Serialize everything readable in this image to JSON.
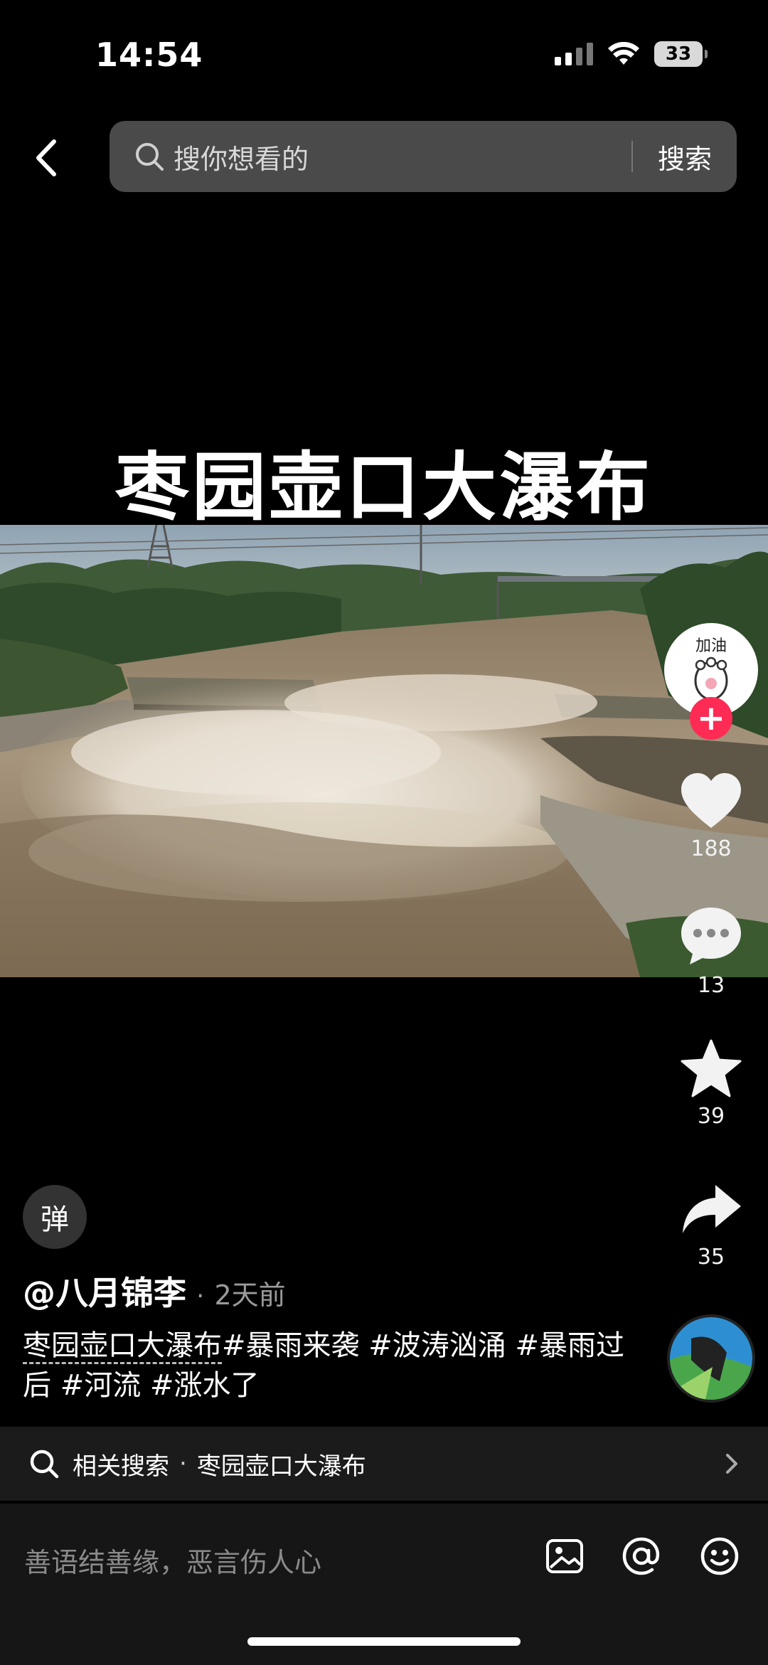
{
  "status_bar": {
    "time": "14:54",
    "battery": "33"
  },
  "search": {
    "placeholder": "搜你想看的",
    "submit_label": "搜索"
  },
  "video": {
    "overlay_title": "枣园壶口大瀑布"
  },
  "author": {
    "name": "@八月锦李",
    "separator": "·",
    "time": "2天前"
  },
  "caption": {
    "keyword": "枣园壶口大瀑布",
    "text": "#暴雨来袭 #波涛汹涌 #暴雨过后 #河流 #涨水了"
  },
  "actions": {
    "avatar_sticker_text": "加油",
    "likes": "188",
    "comments": "13",
    "favorites": "39",
    "shares": "35"
  },
  "danmaku": {
    "label": "弹"
  },
  "related_search": {
    "label": "相关搜索",
    "separator": "·",
    "term": "枣园壶口大瀑布"
  },
  "comment_bar": {
    "placeholder": "善语结善缘，恶言伤人心"
  },
  "colors": {
    "accent": "#fe2c55",
    "background": "#000000",
    "bar": "#161616"
  }
}
